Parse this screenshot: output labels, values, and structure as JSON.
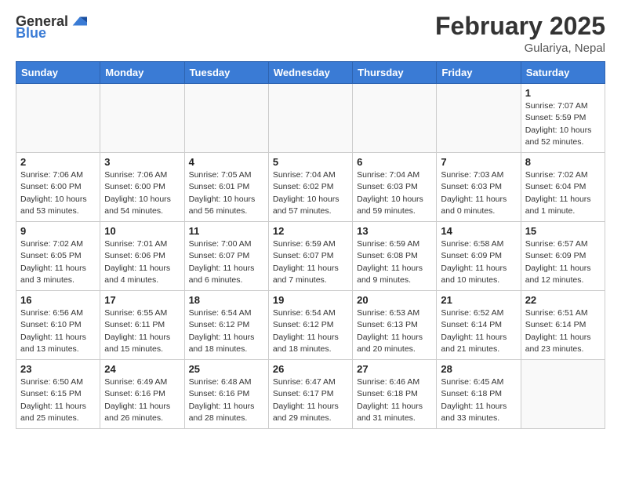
{
  "header": {
    "logo_general": "General",
    "logo_blue": "Blue",
    "title": "February 2025",
    "location": "Gulariya, Nepal"
  },
  "weekdays": [
    "Sunday",
    "Monday",
    "Tuesday",
    "Wednesday",
    "Thursday",
    "Friday",
    "Saturday"
  ],
  "weeks": [
    [
      {
        "day": "",
        "info": ""
      },
      {
        "day": "",
        "info": ""
      },
      {
        "day": "",
        "info": ""
      },
      {
        "day": "",
        "info": ""
      },
      {
        "day": "",
        "info": ""
      },
      {
        "day": "",
        "info": ""
      },
      {
        "day": "1",
        "info": "Sunrise: 7:07 AM\nSunset: 5:59 PM\nDaylight: 10 hours\nand 52 minutes."
      }
    ],
    [
      {
        "day": "2",
        "info": "Sunrise: 7:06 AM\nSunset: 6:00 PM\nDaylight: 10 hours\nand 53 minutes."
      },
      {
        "day": "3",
        "info": "Sunrise: 7:06 AM\nSunset: 6:00 PM\nDaylight: 10 hours\nand 54 minutes."
      },
      {
        "day": "4",
        "info": "Sunrise: 7:05 AM\nSunset: 6:01 PM\nDaylight: 10 hours\nand 56 minutes."
      },
      {
        "day": "5",
        "info": "Sunrise: 7:04 AM\nSunset: 6:02 PM\nDaylight: 10 hours\nand 57 minutes."
      },
      {
        "day": "6",
        "info": "Sunrise: 7:04 AM\nSunset: 6:03 PM\nDaylight: 10 hours\nand 59 minutes."
      },
      {
        "day": "7",
        "info": "Sunrise: 7:03 AM\nSunset: 6:03 PM\nDaylight: 11 hours\nand 0 minutes."
      },
      {
        "day": "8",
        "info": "Sunrise: 7:02 AM\nSunset: 6:04 PM\nDaylight: 11 hours\nand 1 minute."
      }
    ],
    [
      {
        "day": "9",
        "info": "Sunrise: 7:02 AM\nSunset: 6:05 PM\nDaylight: 11 hours\nand 3 minutes."
      },
      {
        "day": "10",
        "info": "Sunrise: 7:01 AM\nSunset: 6:06 PM\nDaylight: 11 hours\nand 4 minutes."
      },
      {
        "day": "11",
        "info": "Sunrise: 7:00 AM\nSunset: 6:07 PM\nDaylight: 11 hours\nand 6 minutes."
      },
      {
        "day": "12",
        "info": "Sunrise: 6:59 AM\nSunset: 6:07 PM\nDaylight: 11 hours\nand 7 minutes."
      },
      {
        "day": "13",
        "info": "Sunrise: 6:59 AM\nSunset: 6:08 PM\nDaylight: 11 hours\nand 9 minutes."
      },
      {
        "day": "14",
        "info": "Sunrise: 6:58 AM\nSunset: 6:09 PM\nDaylight: 11 hours\nand 10 minutes."
      },
      {
        "day": "15",
        "info": "Sunrise: 6:57 AM\nSunset: 6:09 PM\nDaylight: 11 hours\nand 12 minutes."
      }
    ],
    [
      {
        "day": "16",
        "info": "Sunrise: 6:56 AM\nSunset: 6:10 PM\nDaylight: 11 hours\nand 13 minutes."
      },
      {
        "day": "17",
        "info": "Sunrise: 6:55 AM\nSunset: 6:11 PM\nDaylight: 11 hours\nand 15 minutes."
      },
      {
        "day": "18",
        "info": "Sunrise: 6:54 AM\nSunset: 6:12 PM\nDaylight: 11 hours\nand 18 minutes."
      },
      {
        "day": "19",
        "info": "Sunrise: 6:54 AM\nSunset: 6:12 PM\nDaylight: 11 hours\nand 18 minutes."
      },
      {
        "day": "20",
        "info": "Sunrise: 6:53 AM\nSunset: 6:13 PM\nDaylight: 11 hours\nand 20 minutes."
      },
      {
        "day": "21",
        "info": "Sunrise: 6:52 AM\nSunset: 6:14 PM\nDaylight: 11 hours\nand 21 minutes."
      },
      {
        "day": "22",
        "info": "Sunrise: 6:51 AM\nSunset: 6:14 PM\nDaylight: 11 hours\nand 23 minutes."
      }
    ],
    [
      {
        "day": "23",
        "info": "Sunrise: 6:50 AM\nSunset: 6:15 PM\nDaylight: 11 hours\nand 25 minutes."
      },
      {
        "day": "24",
        "info": "Sunrise: 6:49 AM\nSunset: 6:16 PM\nDaylight: 11 hours\nand 26 minutes."
      },
      {
        "day": "25",
        "info": "Sunrise: 6:48 AM\nSunset: 6:16 PM\nDaylight: 11 hours\nand 28 minutes."
      },
      {
        "day": "26",
        "info": "Sunrise: 6:47 AM\nSunset: 6:17 PM\nDaylight: 11 hours\nand 29 minutes."
      },
      {
        "day": "27",
        "info": "Sunrise: 6:46 AM\nSunset: 6:18 PM\nDaylight: 11 hours\nand 31 minutes."
      },
      {
        "day": "28",
        "info": "Sunrise: 6:45 AM\nSunset: 6:18 PM\nDaylight: 11 hours\nand 33 minutes."
      },
      {
        "day": "",
        "info": ""
      }
    ]
  ]
}
